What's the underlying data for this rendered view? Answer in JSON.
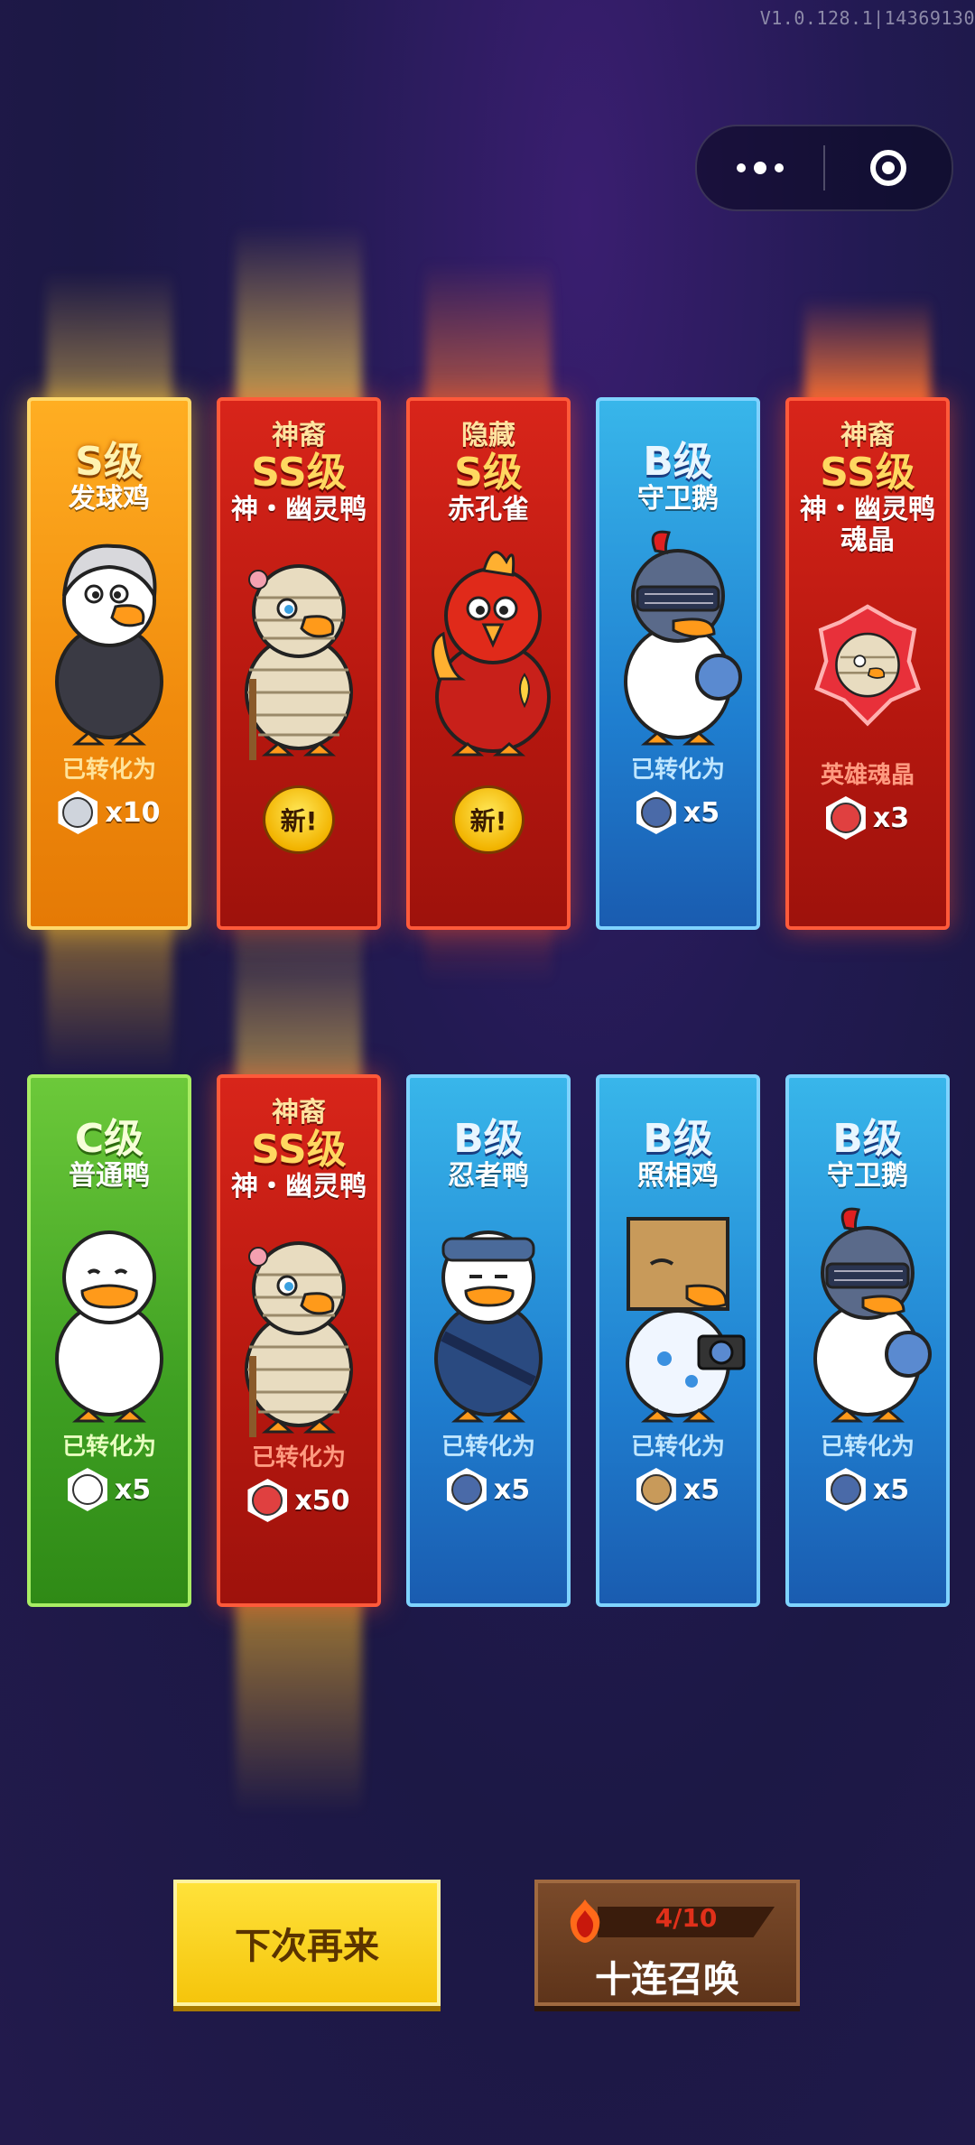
{
  "version": "V1.0.128.1|14369130",
  "capsule": {
    "more_icon": "more-dots-icon",
    "close_icon": "target-circle-icon"
  },
  "cards": [
    {
      "tag": "",
      "grade": "S级",
      "name": "发球鸡",
      "rarity": "gold",
      "footer": "converted",
      "convert_label": "已转化为",
      "qty": "x10",
      "item_color": "#cfd4dc",
      "character": "white-haired-chicken"
    },
    {
      "tag": "神裔",
      "grade": "SS级",
      "name": "神・幽灵鸭",
      "rarity": "red",
      "footer": "new",
      "new_label": "新!",
      "character": "mummy-duck"
    },
    {
      "tag": "隐藏",
      "grade": "S级",
      "name": "赤孔雀",
      "rarity": "red",
      "footer": "new",
      "new_label": "新!",
      "character": "red-peacock"
    },
    {
      "tag": "",
      "grade": "B级",
      "name": "守卫鹅",
      "rarity": "blue",
      "footer": "converted",
      "convert_label": "已转化为",
      "qty": "x5",
      "item_color": "#4a6aa8",
      "character": "knight-goose"
    },
    {
      "tag": "神裔",
      "grade": "SS级",
      "name": "神・幽灵鸭\n魂晶",
      "rarity": "red",
      "footer": "converted",
      "convert_label": "英雄魂晶",
      "qty": "x3",
      "item_color": "#e04040",
      "character": "soul-crystal"
    },
    {
      "tag": "",
      "grade": "C级",
      "name": "普通鸭",
      "rarity": "green",
      "footer": "converted",
      "convert_label": "已转化为",
      "qty": "x5",
      "item_color": "#ffffff",
      "character": "plain-duck"
    },
    {
      "tag": "神裔",
      "grade": "SS级",
      "name": "神・幽灵鸭",
      "rarity": "red",
      "footer": "converted",
      "convert_label": "已转化为",
      "qty": "x50",
      "item_color": "#e04040",
      "character": "mummy-duck"
    },
    {
      "tag": "",
      "grade": "B级",
      "name": "忍者鸭",
      "rarity": "blue",
      "footer": "converted",
      "convert_label": "已转化为",
      "qty": "x5",
      "item_color": "#4a6aa8",
      "character": "ninja-duck"
    },
    {
      "tag": "",
      "grade": "B级",
      "name": "照相鸡",
      "rarity": "blue",
      "footer": "converted",
      "convert_label": "已转化为",
      "qty": "x5",
      "item_color": "#c89a5a",
      "character": "camera-chicken"
    },
    {
      "tag": "",
      "grade": "B级",
      "name": "守卫鹅",
      "rarity": "blue",
      "footer": "converted",
      "convert_label": "已转化为",
      "qty": "x5",
      "item_color": "#4a6aa8",
      "character": "knight-goose"
    }
  ],
  "buttons": {
    "next_label": "下次再来",
    "ten_label": "十连召唤",
    "ten_count": "4/10",
    "ten_icon": "flame-crest-icon"
  }
}
